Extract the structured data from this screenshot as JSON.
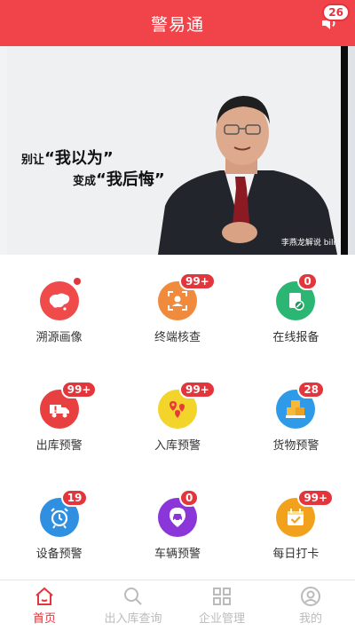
{
  "header": {
    "title": "警易通",
    "notification_count": "26"
  },
  "banner": {
    "line1_prefix": "别让",
    "line1_big": "“我以为”",
    "line2_prefix": "变成",
    "line2_big": "“我后悔”",
    "credit": "李燕龙解说 bili"
  },
  "grid": {
    "items": [
      {
        "label": "溯源画像",
        "badge": "",
        "dot": true,
        "color": "#ef4b4b",
        "icon": "china-map-icon"
      },
      {
        "label": "终端核查",
        "badge": "99+",
        "color": "#f08a3c",
        "icon": "terminal-scan-icon"
      },
      {
        "label": "在线报备",
        "badge": "0",
        "color": "#2bb673",
        "icon": "document-edit-icon"
      },
      {
        "label": "出库预警",
        "badge": "99+",
        "color": "#e84040",
        "icon": "truck-alert-icon"
      },
      {
        "label": "入库预警",
        "badge": "99+",
        "color": "#f3d42b",
        "icon": "location-pins-icon"
      },
      {
        "label": "货物预警",
        "badge": "28",
        "color": "#2f9be8",
        "icon": "boxes-icon"
      },
      {
        "label": "设备预警",
        "badge": "19",
        "color": "#2f8fe0",
        "icon": "alarm-clock-icon"
      },
      {
        "label": "车辆预警",
        "badge": "0",
        "color": "#8a36d8",
        "icon": "car-pin-icon"
      },
      {
        "label": "每日打卡",
        "badge": "99+",
        "color": "#f2a11c",
        "icon": "calendar-check-icon"
      }
    ]
  },
  "nav": {
    "items": [
      {
        "label": "首页",
        "active": true,
        "icon": "home-icon"
      },
      {
        "label": "出入库查询",
        "active": false,
        "icon": "search-icon"
      },
      {
        "label": "企业管理",
        "active": false,
        "icon": "grid-icon"
      },
      {
        "label": "我的",
        "active": false,
        "icon": "user-icon"
      }
    ]
  },
  "colors": {
    "brand": "#f0444a",
    "badge": "#e3353c",
    "nav_inactive": "#bbbbbb"
  }
}
